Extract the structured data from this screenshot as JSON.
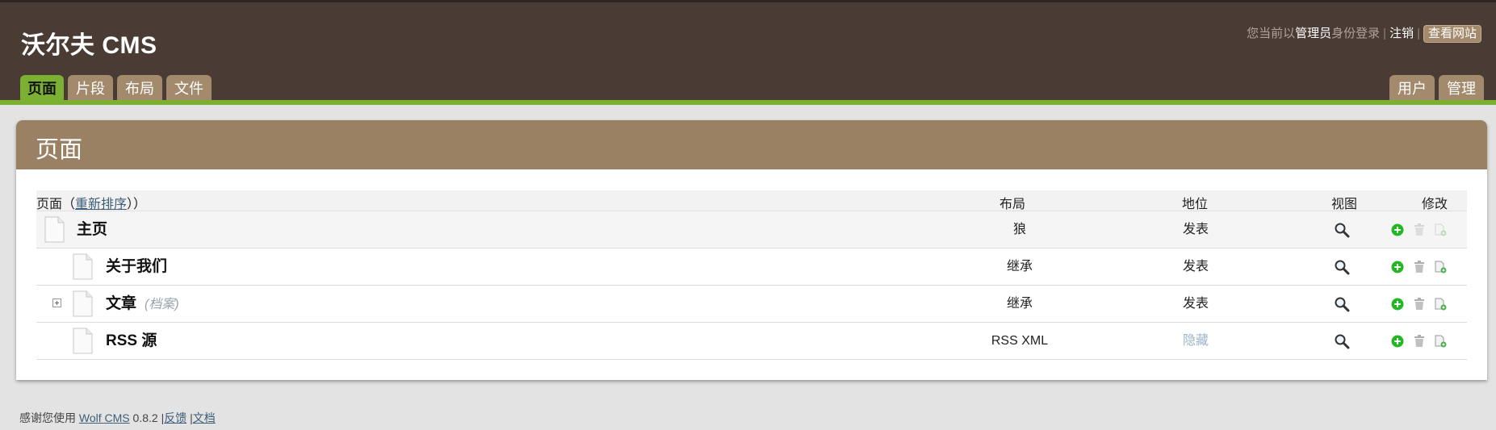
{
  "header": {
    "site_title": "沃尔夫 CMS",
    "user_info": {
      "prefix": "您当前以",
      "role": "管理员",
      "suffix": "身份登录",
      "separator": "|",
      "logout": "注销",
      "view_site": "查看网站"
    },
    "tabs_left": [
      "页面",
      "片段",
      "布局",
      "文件"
    ],
    "active_tab": "页面",
    "tabs_right": [
      "用户",
      "管理"
    ]
  },
  "panel": {
    "title": "页面",
    "columns": {
      "page_prefix": "页面（",
      "reorder_link": "重新排序",
      "page_suffix": "））",
      "layout": "布局",
      "status": "地位",
      "view": "视图",
      "modify": "修改"
    },
    "rows": [
      {
        "name": "主页",
        "layout": "狼",
        "status": "发表",
        "level": 0,
        "expandable": false,
        "note": ""
      },
      {
        "name": "关于我们",
        "layout": "继承",
        "status": "发表",
        "level": 1,
        "expandable": false,
        "note": ""
      },
      {
        "name": "文章",
        "layout": "继承",
        "status": "发表",
        "level": 1,
        "expandable": true,
        "note": "(档案)"
      },
      {
        "name": "RSS 源",
        "layout": "RSS XML",
        "status": "隐藏",
        "level": 1,
        "expandable": false,
        "note": ""
      }
    ]
  },
  "footer": {
    "thanks": "感谢您使用",
    "link": "Wolf CMS",
    "version": "0.8.2",
    "sep1": "|",
    "feedback": "反馈",
    "sep2": "|",
    "docs": "文档"
  },
  "colors": {
    "header_bg": "#4a3c35",
    "accent_green": "#7bb032",
    "tab_brown": "#a38a6c",
    "panel_head": "#9a8163",
    "add_icon_green": "#22b822"
  },
  "icons": [
    "page-icon",
    "expand-icon",
    "magnifier-icon",
    "add-child-icon",
    "delete-icon",
    "copy-page-icon"
  ]
}
